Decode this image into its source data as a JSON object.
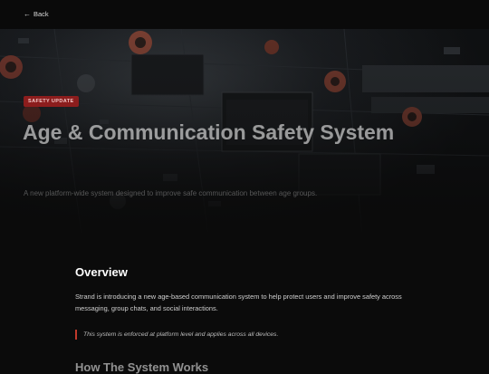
{
  "nav": {
    "back_label": "Back"
  },
  "hero": {
    "badge": "SAFETY UPDATE",
    "title": "Age & Communication Safety System",
    "subtitle": "A new platform-wide system designed to improve safe communication between age groups."
  },
  "overview": {
    "heading": "Overview",
    "paragraph": "Strand is introducing a new age-based communication system to help protect users and improve safety across messaging, group chats, and social interactions.",
    "callout": "This system is enforced at platform level and applies across all devices."
  },
  "next_section": {
    "heading": "How The System Works"
  },
  "colors": {
    "accent": "#c0392b",
    "badge_bg": "#8c1d1d",
    "background": "#0b0b0b"
  }
}
